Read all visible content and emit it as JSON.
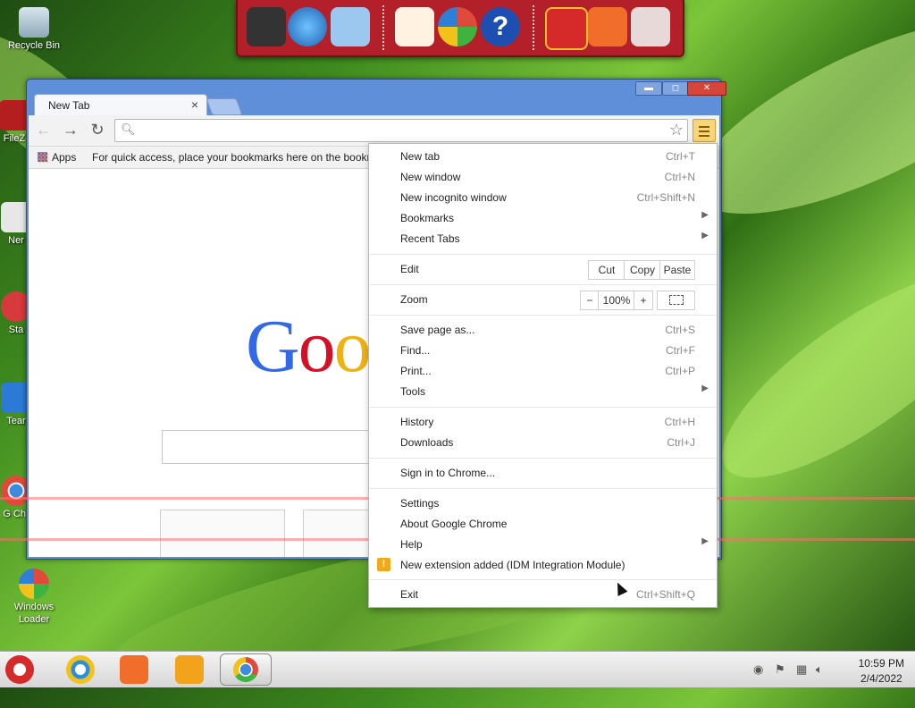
{
  "desktop": {
    "icons": [
      {
        "label": "Recycle Bin"
      },
      {
        "label": "FileZ"
      },
      {
        "label": "Ner"
      },
      {
        "label": "Sta"
      },
      {
        "label": "Tear"
      },
      {
        "label": "G Chr"
      },
      {
        "label": "Windows Loader"
      }
    ]
  },
  "dock": {
    "icons": [
      "computer-icon",
      "internet-globe-icon",
      "control-panel-icon",
      "snowman-icon",
      "media-center-icon",
      "help-icon",
      "gift-icon",
      "folder-icon",
      "recycle-bin-icon"
    ]
  },
  "browser": {
    "tab_title": "New Tab",
    "tab_close": "×",
    "window_controls": {
      "minimize": "▬",
      "maximize": "◻",
      "close": "✕"
    },
    "address_value": "",
    "bookmarks_bar": {
      "apps_label": "Apps",
      "hint": "For quick access, place your bookmarks here on the bookm"
    },
    "google_logo": [
      "G",
      "o",
      "o"
    ]
  },
  "menu": {
    "new_tab": {
      "label": "New tab",
      "shortcut": "Ctrl+T"
    },
    "new_window": {
      "label": "New window",
      "shortcut": "Ctrl+N"
    },
    "new_incognito": {
      "label": "New incognito window",
      "shortcut": "Ctrl+Shift+N"
    },
    "bookmarks": {
      "label": "Bookmarks"
    },
    "recent_tabs": {
      "label": "Recent Tabs"
    },
    "edit": {
      "label": "Edit",
      "cut": "Cut",
      "copy": "Copy",
      "paste": "Paste"
    },
    "zoom": {
      "label": "Zoom",
      "minus": "−",
      "value": "100%",
      "plus": "+"
    },
    "save_page": {
      "label": "Save page as...",
      "shortcut": "Ctrl+S"
    },
    "find": {
      "label": "Find...",
      "shortcut": "Ctrl+F"
    },
    "print": {
      "label": "Print...",
      "shortcut": "Ctrl+P"
    },
    "tools": {
      "label": "Tools"
    },
    "history": {
      "label": "History",
      "shortcut": "Ctrl+H"
    },
    "downloads": {
      "label": "Downloads",
      "shortcut": "Ctrl+J"
    },
    "sign_in": {
      "label": "Sign in to Chrome..."
    },
    "settings": {
      "label": "Settings"
    },
    "about": {
      "label": "About Google Chrome"
    },
    "help": {
      "label": "Help"
    },
    "extension": {
      "label": "New extension added (IDM Integration Module)"
    },
    "exit": {
      "label": "Exit",
      "shortcut": "Ctrl+Shift+Q"
    }
  },
  "taskbar": {
    "time": "10:59 PM",
    "date": "2/4/2022"
  },
  "colors": {
    "menu_accent": "#f1a81b",
    "window_frame": "#5f8fd8",
    "dock": "#b3202a"
  }
}
